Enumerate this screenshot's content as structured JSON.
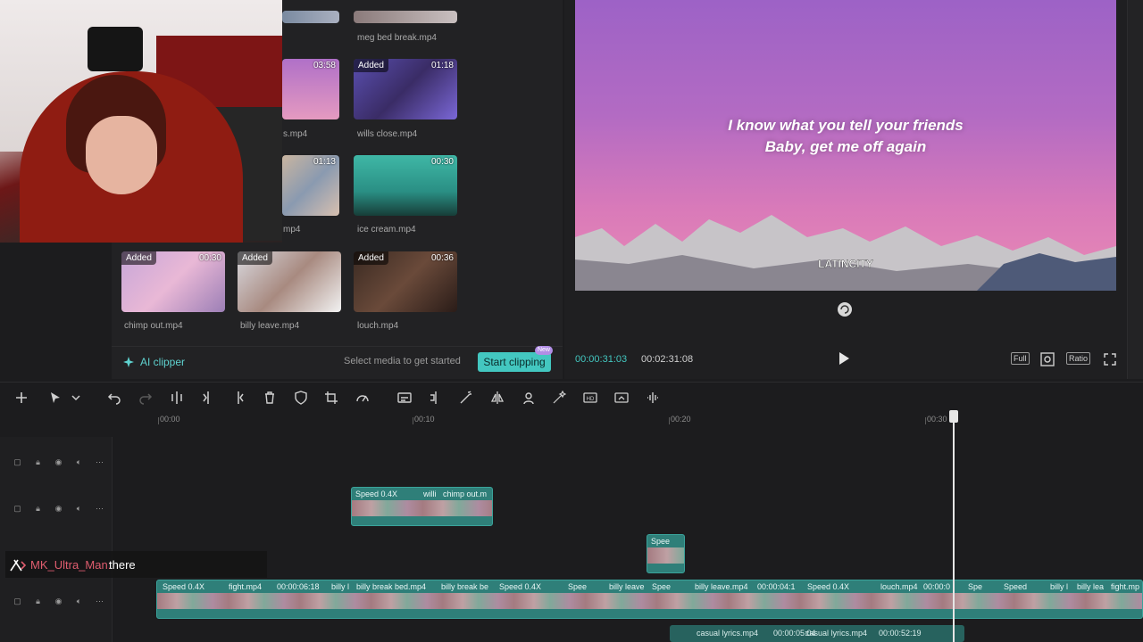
{
  "media": {
    "items": [
      {
        "label": "meg bed break.mp4",
        "added": false,
        "duration": ""
      },
      {
        "label": "s.mp4",
        "added": false,
        "duration": "03:58"
      },
      {
        "label": "wills close.mp4",
        "added": true,
        "duration": "01:18"
      },
      {
        "label": "mp4",
        "added": false,
        "duration": "01:13"
      },
      {
        "label": "ice cream.mp4",
        "added": false,
        "duration": "00:30"
      },
      {
        "label": "chimp out.mp4",
        "added": true,
        "duration": "00:30"
      },
      {
        "label": "billy leave.mp4",
        "added": true,
        "duration": ""
      },
      {
        "label": "louch.mp4",
        "added": true,
        "duration": "00:36"
      }
    ],
    "added_badge": "Added",
    "ai_clipper": "AI clipper",
    "hint": "Select media to get started",
    "start_clipping": "Start clipping",
    "new_badge": "New"
  },
  "preview": {
    "lyric_line1": "I know what you tell your friends",
    "lyric_line2": "Baby, get me off again",
    "watermark": "LATINCITY",
    "time_current": "00:00:31:03",
    "time_total": "00:02:31:08",
    "full_label": "Full",
    "ratio_label": "Ratio"
  },
  "ruler": {
    "ticks": [
      "00:00",
      "00:10",
      "00:20",
      "00:30"
    ]
  },
  "tracks": {
    "clip_upper_speed": "Speed 0.4X",
    "clip_upper_name1": "willi",
    "clip_upper_name2": "chimp out.m",
    "clip_mid_speed": "Spee",
    "main_segments": [
      "Speed 0.4X",
      "fight.mp4",
      "00:00:06:18",
      "billy l",
      "billy break bed.mp4",
      "billy break be",
      "Speed 0.4X",
      "Spee",
      "billy leave",
      "Spee",
      "billy leave.mp4",
      "00:00:04:1",
      "Speed 0.4X",
      "louch.mp4",
      "00:00:0",
      "Spe",
      "Speed",
      "billy l",
      "billy lea",
      "fight.mp"
    ],
    "audio_name1": "casual lyrics.mp4",
    "audio_time1": "00:00:05:04",
    "audio_name2": "casual lyrics.mp4",
    "audio_time2": "00:00:52:19"
  },
  "chat": {
    "username": "MK_Ultra_Man:",
    "message": "there"
  },
  "colors": {
    "accent": "#43c7c0",
    "clip": "#2f7f79",
    "background": "#1c1c1e"
  }
}
